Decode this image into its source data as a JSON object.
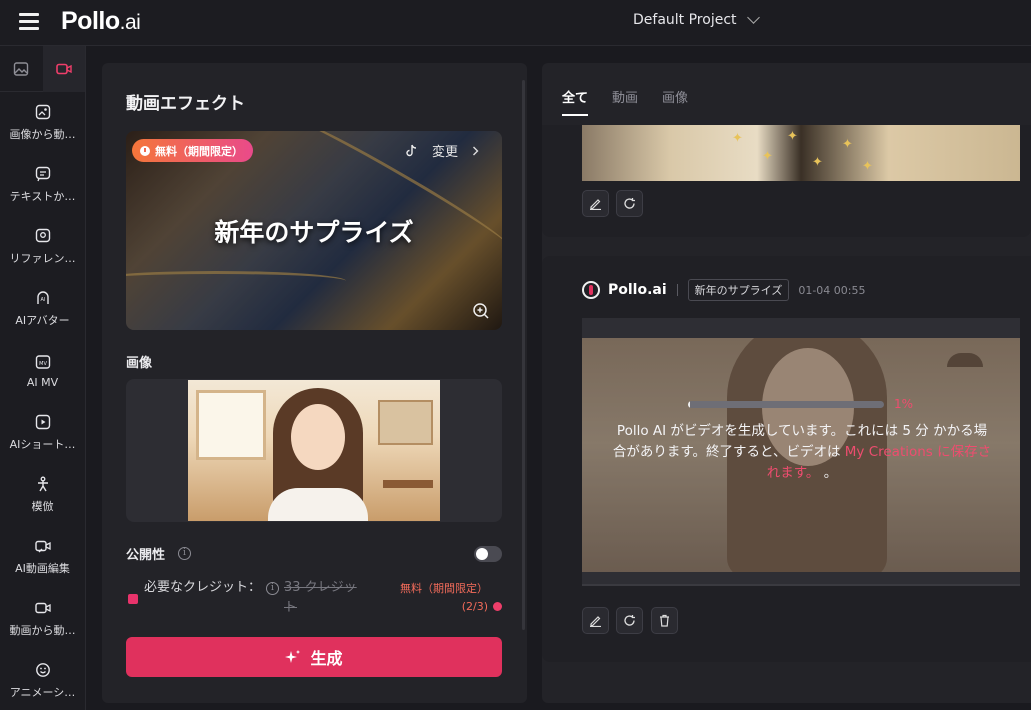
{
  "header": {
    "logo": "Pollo",
    "logo_suffix": ".ai",
    "project": "Default Project"
  },
  "sidebar": {
    "tabs": [
      {
        "icon": "image-icon",
        "active": false
      },
      {
        "icon": "video-icon",
        "active": true
      }
    ],
    "items": [
      {
        "label": "画像から動…",
        "icon": "image-to-video-icon"
      },
      {
        "label": "テキストか…",
        "icon": "text-to-video-icon"
      },
      {
        "label": "リファレン…",
        "icon": "reference-icon"
      },
      {
        "label": "AIアバター",
        "icon": "ai-avatar-icon"
      },
      {
        "label": "AI MV",
        "icon": "ai-mv-icon"
      },
      {
        "label": "AIショート…",
        "icon": "ai-short-icon"
      },
      {
        "label": "模倣",
        "icon": "imitate-icon"
      },
      {
        "label": "AI動画編集",
        "icon": "ai-video-edit-icon"
      },
      {
        "label": "動画から動…",
        "icon": "video-to-video-icon"
      },
      {
        "label": "アニメーシ…",
        "icon": "animation-icon"
      }
    ]
  },
  "left_panel": {
    "title": "動画エフェクト",
    "effect": {
      "badge": "無料（期間限定）",
      "change": "変更",
      "name": "新年のサプライズ"
    },
    "image_label": "画像",
    "public_label": "公開性",
    "public_enabled": false,
    "credits": {
      "label": "必要なクレジット：",
      "original": "33 クレジット",
      "free": "無料（期間限定）(2/3)"
    },
    "generate": "生成"
  },
  "right_panel": {
    "tabs": [
      "全て",
      "動画",
      "画像"
    ],
    "active_tab": "全て",
    "job": {
      "brand": "Pollo.ai",
      "tag": "新年のサプライズ",
      "timestamp": "01-04 00:55",
      "progress_fraction": 0.01,
      "progress_text": "1%",
      "message_before": "Pollo AI がビデオを生成しています。これには 5 分 かかる場合があります。終了すると、ビデオは ",
      "message_link": "My Creations に保存されます。",
      "message_after": " 。"
    }
  },
  "colors": {
    "accent": "#e0315d",
    "accent_text": "#ee4d6f",
    "panel_bg": "#232328",
    "page_bg": "#1a1a1f"
  }
}
